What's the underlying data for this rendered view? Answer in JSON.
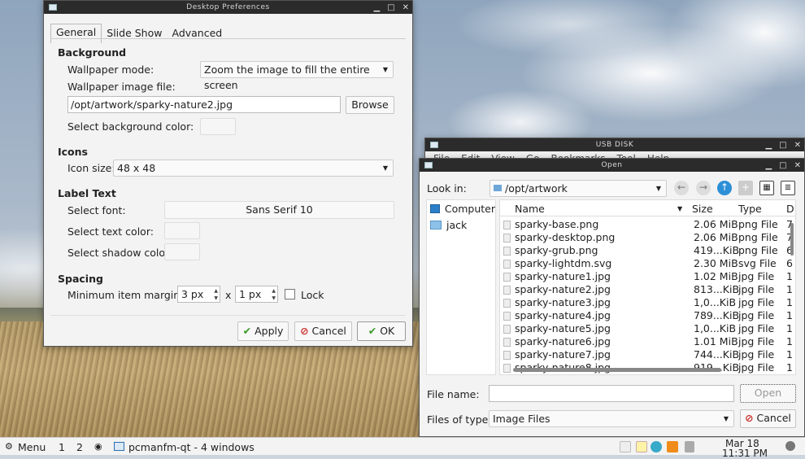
{
  "pref": {
    "title": "Desktop Preferences",
    "tabs": [
      "General",
      "Slide Show",
      "Advanced"
    ],
    "background": {
      "heading": "Background",
      "wallpaper_mode_label": "Wallpaper mode:",
      "wallpaper_mode": "Zoom the image to fill the entire screen",
      "wallpaper_file_label": "Wallpaper image file:",
      "wallpaper_file": "/opt/artwork/sparky-nature2.jpg",
      "browse": "Browse",
      "bg_color_label": "Select background color:"
    },
    "icons": {
      "heading": "Icons",
      "icon_size_label": "Icon size:",
      "icon_size": "48 x 48"
    },
    "label_text": {
      "heading": "Label Text",
      "font_label": "Select font:",
      "font": "Sans Serif 10",
      "text_color_label": "Select text color:",
      "shadow_color_label": "Select shadow color:"
    },
    "spacing": {
      "heading": "Spacing",
      "margins_label": "Minimum item margins:",
      "margin_x": "3 px",
      "x": "x",
      "margin_y": "1 px",
      "lock": "Lock"
    },
    "buttons": {
      "apply": "Apply",
      "cancel": "Cancel",
      "ok": "OK"
    }
  },
  "usb": {
    "title": "USB DISK",
    "menu": [
      "File",
      "Edit",
      "View",
      "Go",
      "Bookmarks",
      "Tool",
      "Help"
    ]
  },
  "open": {
    "title": "Open",
    "look_in_label": "Look in:",
    "look_in": "/opt/artwork",
    "places": [
      "Computer",
      "jack"
    ],
    "columns": {
      "name": "Name",
      "size": "Size",
      "type": "Type",
      "date": "D"
    },
    "files": [
      {
        "name": "sparky-base.png",
        "size": "2.06 MiB",
        "type": "png File",
        "d": "7"
      },
      {
        "name": "sparky-desktop.png",
        "size": "2.06 MiB",
        "type": "png File",
        "d": "7"
      },
      {
        "name": "sparky-grub.png",
        "size": "419...KiB",
        "type": "png File",
        "d": "6"
      },
      {
        "name": "sparky-lightdm.svg",
        "size": "2.30 MiB",
        "type": "svg File",
        "d": "6"
      },
      {
        "name": "sparky-nature1.jpg",
        "size": "1.02 MiB",
        "type": "jpg File",
        "d": "1"
      },
      {
        "name": "sparky-nature2.jpg",
        "size": "813...KiB",
        "type": "jpg File",
        "d": "1"
      },
      {
        "name": "sparky-nature3.jpg",
        "size": "1,0...KiB",
        "type": "jpg File",
        "d": "1"
      },
      {
        "name": "sparky-nature4.jpg",
        "size": "789...KiB",
        "type": "jpg File",
        "d": "1"
      },
      {
        "name": "sparky-nature5.jpg",
        "size": "1,0...KiB",
        "type": "jpg File",
        "d": "1"
      },
      {
        "name": "sparky-nature6.jpg",
        "size": "1.01 MiB",
        "type": "jpg File",
        "d": "1"
      },
      {
        "name": "sparky-nature7.jpg",
        "size": "744...KiB",
        "type": "jpg File",
        "d": "1"
      },
      {
        "name": "sparky-nature8.jpg",
        "size": "919...KiB",
        "type": "jpg File",
        "d": "1"
      }
    ],
    "file_name_label": "File name:",
    "file_name": "",
    "files_of_type_label": "Files of type:",
    "files_of_type": "Image Files",
    "open_btn": "Open",
    "cancel_btn": "Cancel"
  },
  "taskbar": {
    "menu": "Menu",
    "desk1": "1",
    "desk2": "2",
    "task": "pcmanfm-qt - 4 windows",
    "date": "Mar 18",
    "time": "11:31 PM"
  }
}
